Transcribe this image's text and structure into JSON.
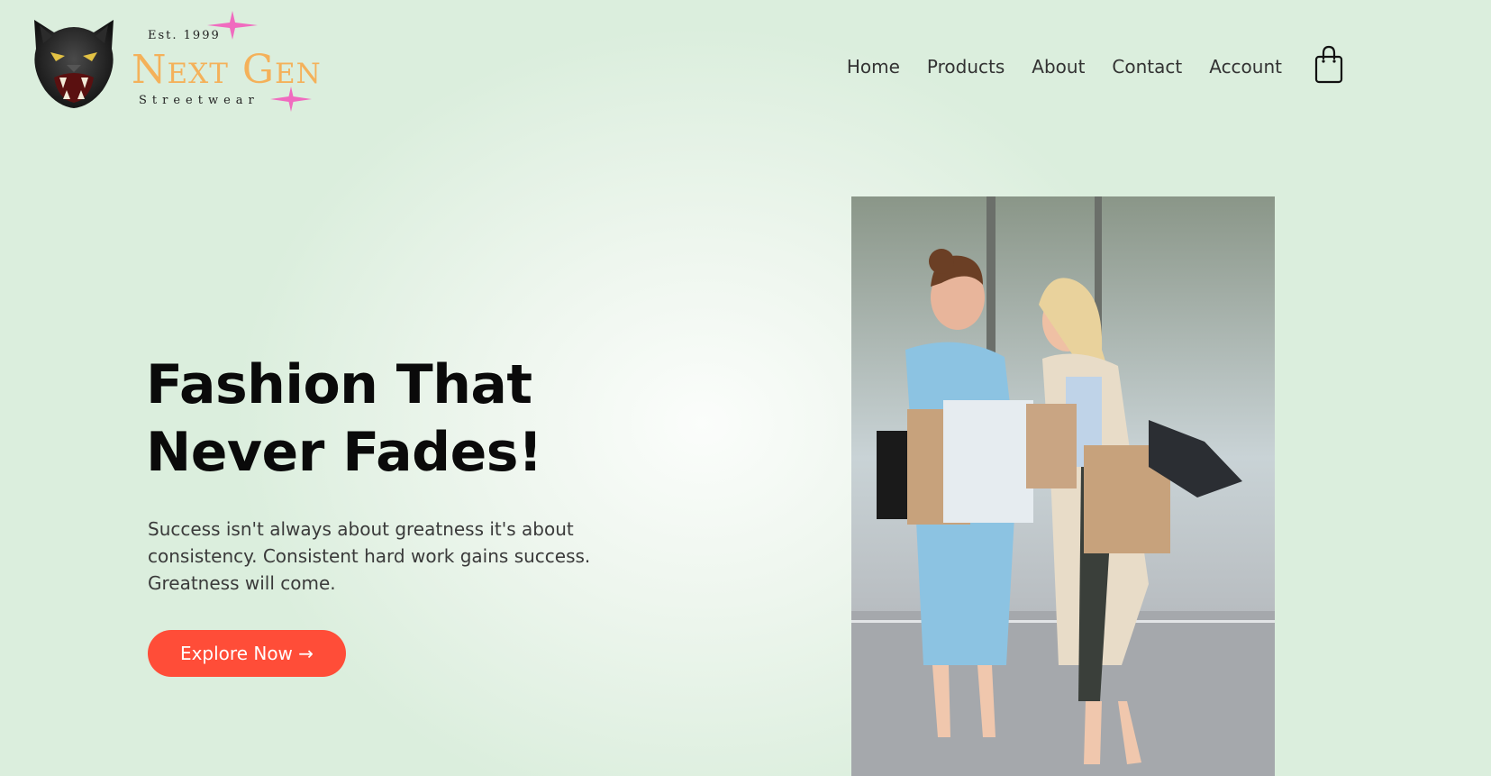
{
  "brand": {
    "est": "Est. 1999",
    "name": "Next Gen",
    "tagline": "Streetwear",
    "logo_icon": "panther-icon",
    "accent_sparkle": "#f06bbf",
    "name_color": "#f4b15a"
  },
  "nav": {
    "items": [
      {
        "label": "Home"
      },
      {
        "label": "Products"
      },
      {
        "label": "About"
      },
      {
        "label": "Contact"
      },
      {
        "label": "Account"
      }
    ],
    "cart_icon": "shopping-bag-icon"
  },
  "hero": {
    "title_line1": "Fashion That",
    "title_line2": "Never Fades!",
    "text": "Success isn't always about greatness it's about consistency. Consistent hard work gains success. Greatness will come.",
    "cta_label": "Explore Now →",
    "cta_color": "#ff4d38",
    "image_icon": "shopping-women-photo"
  }
}
